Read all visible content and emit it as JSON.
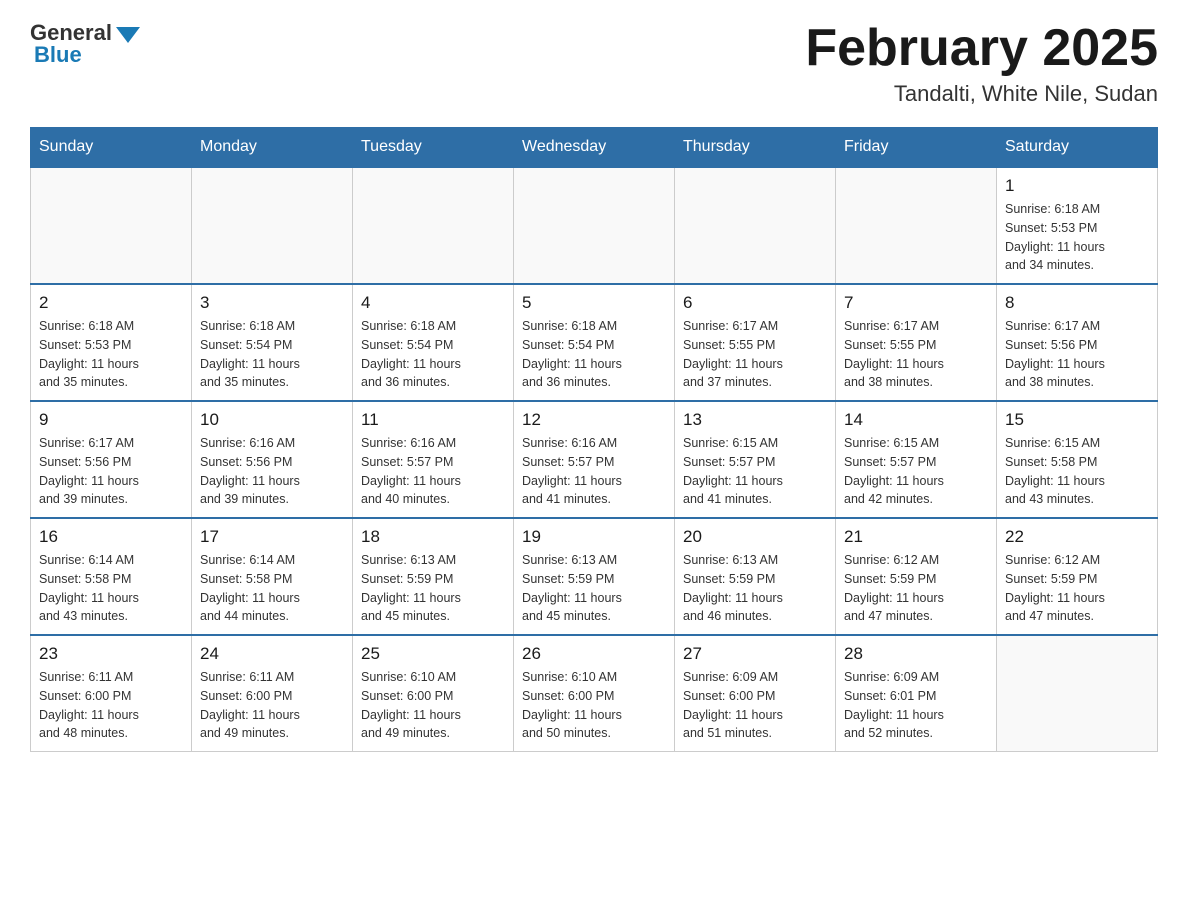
{
  "logo": {
    "general": "General",
    "blue": "Blue"
  },
  "title": {
    "month": "February 2025",
    "location": "Tandalti, White Nile, Sudan"
  },
  "days_of_week": [
    "Sunday",
    "Monday",
    "Tuesday",
    "Wednesday",
    "Thursday",
    "Friday",
    "Saturday"
  ],
  "weeks": [
    [
      {
        "day": "",
        "info": ""
      },
      {
        "day": "",
        "info": ""
      },
      {
        "day": "",
        "info": ""
      },
      {
        "day": "",
        "info": ""
      },
      {
        "day": "",
        "info": ""
      },
      {
        "day": "",
        "info": ""
      },
      {
        "day": "1",
        "info": "Sunrise: 6:18 AM\nSunset: 5:53 PM\nDaylight: 11 hours\nand 34 minutes."
      }
    ],
    [
      {
        "day": "2",
        "info": "Sunrise: 6:18 AM\nSunset: 5:53 PM\nDaylight: 11 hours\nand 35 minutes."
      },
      {
        "day": "3",
        "info": "Sunrise: 6:18 AM\nSunset: 5:54 PM\nDaylight: 11 hours\nand 35 minutes."
      },
      {
        "day": "4",
        "info": "Sunrise: 6:18 AM\nSunset: 5:54 PM\nDaylight: 11 hours\nand 36 minutes."
      },
      {
        "day": "5",
        "info": "Sunrise: 6:18 AM\nSunset: 5:54 PM\nDaylight: 11 hours\nand 36 minutes."
      },
      {
        "day": "6",
        "info": "Sunrise: 6:17 AM\nSunset: 5:55 PM\nDaylight: 11 hours\nand 37 minutes."
      },
      {
        "day": "7",
        "info": "Sunrise: 6:17 AM\nSunset: 5:55 PM\nDaylight: 11 hours\nand 38 minutes."
      },
      {
        "day": "8",
        "info": "Sunrise: 6:17 AM\nSunset: 5:56 PM\nDaylight: 11 hours\nand 38 minutes."
      }
    ],
    [
      {
        "day": "9",
        "info": "Sunrise: 6:17 AM\nSunset: 5:56 PM\nDaylight: 11 hours\nand 39 minutes."
      },
      {
        "day": "10",
        "info": "Sunrise: 6:16 AM\nSunset: 5:56 PM\nDaylight: 11 hours\nand 39 minutes."
      },
      {
        "day": "11",
        "info": "Sunrise: 6:16 AM\nSunset: 5:57 PM\nDaylight: 11 hours\nand 40 minutes."
      },
      {
        "day": "12",
        "info": "Sunrise: 6:16 AM\nSunset: 5:57 PM\nDaylight: 11 hours\nand 41 minutes."
      },
      {
        "day": "13",
        "info": "Sunrise: 6:15 AM\nSunset: 5:57 PM\nDaylight: 11 hours\nand 41 minutes."
      },
      {
        "day": "14",
        "info": "Sunrise: 6:15 AM\nSunset: 5:57 PM\nDaylight: 11 hours\nand 42 minutes."
      },
      {
        "day": "15",
        "info": "Sunrise: 6:15 AM\nSunset: 5:58 PM\nDaylight: 11 hours\nand 43 minutes."
      }
    ],
    [
      {
        "day": "16",
        "info": "Sunrise: 6:14 AM\nSunset: 5:58 PM\nDaylight: 11 hours\nand 43 minutes."
      },
      {
        "day": "17",
        "info": "Sunrise: 6:14 AM\nSunset: 5:58 PM\nDaylight: 11 hours\nand 44 minutes."
      },
      {
        "day": "18",
        "info": "Sunrise: 6:13 AM\nSunset: 5:59 PM\nDaylight: 11 hours\nand 45 minutes."
      },
      {
        "day": "19",
        "info": "Sunrise: 6:13 AM\nSunset: 5:59 PM\nDaylight: 11 hours\nand 45 minutes."
      },
      {
        "day": "20",
        "info": "Sunrise: 6:13 AM\nSunset: 5:59 PM\nDaylight: 11 hours\nand 46 minutes."
      },
      {
        "day": "21",
        "info": "Sunrise: 6:12 AM\nSunset: 5:59 PM\nDaylight: 11 hours\nand 47 minutes."
      },
      {
        "day": "22",
        "info": "Sunrise: 6:12 AM\nSunset: 5:59 PM\nDaylight: 11 hours\nand 47 minutes."
      }
    ],
    [
      {
        "day": "23",
        "info": "Sunrise: 6:11 AM\nSunset: 6:00 PM\nDaylight: 11 hours\nand 48 minutes."
      },
      {
        "day": "24",
        "info": "Sunrise: 6:11 AM\nSunset: 6:00 PM\nDaylight: 11 hours\nand 49 minutes."
      },
      {
        "day": "25",
        "info": "Sunrise: 6:10 AM\nSunset: 6:00 PM\nDaylight: 11 hours\nand 49 minutes."
      },
      {
        "day": "26",
        "info": "Sunrise: 6:10 AM\nSunset: 6:00 PM\nDaylight: 11 hours\nand 50 minutes."
      },
      {
        "day": "27",
        "info": "Sunrise: 6:09 AM\nSunset: 6:00 PM\nDaylight: 11 hours\nand 51 minutes."
      },
      {
        "day": "28",
        "info": "Sunrise: 6:09 AM\nSunset: 6:01 PM\nDaylight: 11 hours\nand 52 minutes."
      },
      {
        "day": "",
        "info": ""
      }
    ]
  ]
}
